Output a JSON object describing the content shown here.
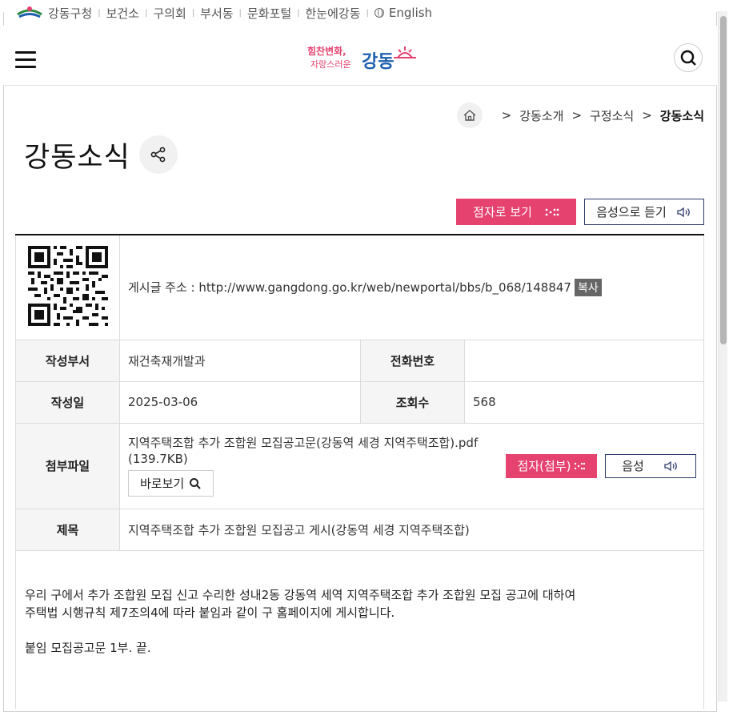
{
  "topbar": {
    "links": [
      "강동구청",
      "보건소",
      "구의회",
      "부서동",
      "문화포털",
      "한눈에강동"
    ],
    "english": "English"
  },
  "header": {
    "brand_line1": "힘찬변화,",
    "brand_line2": "자랑스러운",
    "brand_name": "강동",
    "menu_icon": "hamburger-icon",
    "search_icon": "search-icon"
  },
  "breadcrumb": {
    "items": [
      "강동소개",
      "구정소식"
    ],
    "current": "강동소식"
  },
  "page": {
    "title": "강동소식"
  },
  "actions": {
    "braille_label": "점자로 보기",
    "voice_label": "음성으로 듣기"
  },
  "post": {
    "url_label": "게시글 주소 : http://www.gangdong.go.kr/web/newportal/bbs/b_068/148847",
    "copy_label": "복사",
    "dept_label": "작성부서",
    "dept_value": "재건축재개발과",
    "phone_label": "전화번호",
    "phone_value": "",
    "date_label": "작성일",
    "date_value": "2025-03-06",
    "views_label": "조회수",
    "views_value": "568",
    "attach_label": "첨부파일",
    "attach_name": "지역주택조합 추가 조합원 모집공고문(강동역 세경 지역주택조합).pdf",
    "attach_size": "(139.7KB)",
    "view_button": "바로보기",
    "attach_braille": "점자(첨부)",
    "attach_voice": "음성",
    "subject_label": "제목",
    "subject_value": "지역주택조합 추가 조합원 모집공고 게시(강동역 세경 지역주택조합)"
  },
  "content": {
    "line1": "우리 구에서 추가 조합원 모집 신고 수리한 성내2동 강동역 세역 지역주택조합 추가 조합원 모집 공고에 대하여",
    "line2": "주택법 시행규칙 제7조의4에 따라 붙임과 같이 구 홈페이지에 게시합니다.",
    "line3": "붙임  모집공고문 1부.  끝."
  },
  "colors": {
    "accent": "#e5426f",
    "navy": "#2d3a6b"
  }
}
